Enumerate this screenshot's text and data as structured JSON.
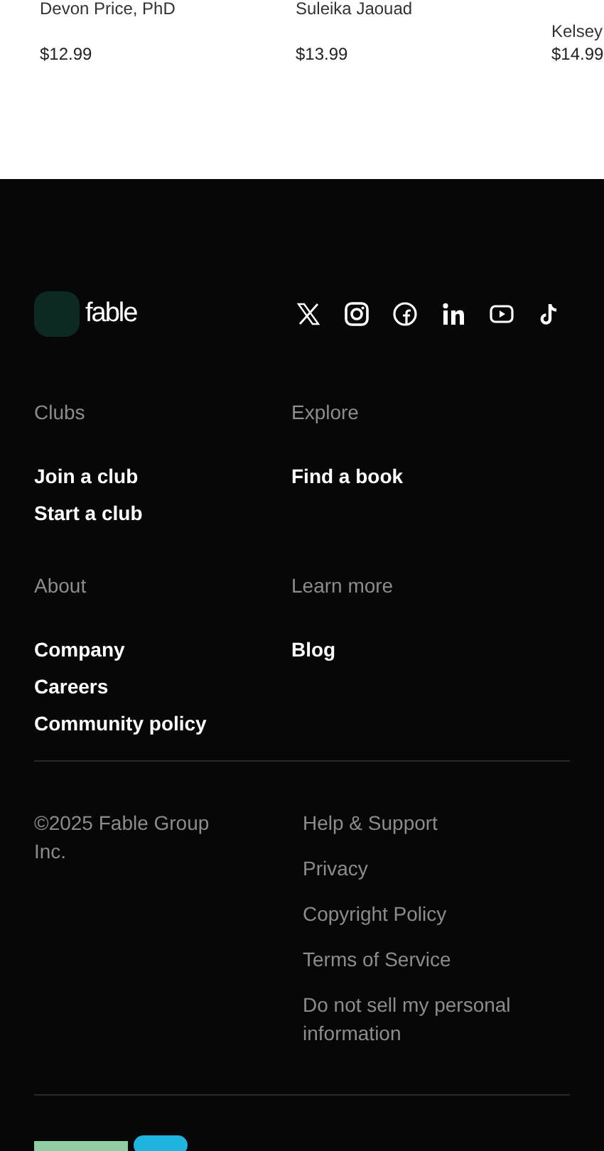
{
  "books": [
    {
      "author": "Devon Price, PhD",
      "price": "$12.99"
    },
    {
      "author": "Suleika Jaouad",
      "price": "$13.99"
    },
    {
      "author": "Kelsey",
      "price": "$14.99"
    }
  ],
  "footer": {
    "brand": "fable",
    "social": [
      {
        "kind": "x"
      },
      {
        "kind": "instagram"
      },
      {
        "kind": "facebook"
      },
      {
        "kind": "linkedin"
      },
      {
        "kind": "youtube"
      },
      {
        "kind": "tiktok"
      }
    ],
    "sections": [
      {
        "heading": "Clubs",
        "links": [
          "Join a club",
          "Start a club"
        ]
      },
      {
        "heading": "Explore",
        "links": [
          "Find a book"
        ]
      },
      {
        "heading": "About",
        "links": [
          "Company",
          "Careers",
          "Community policy"
        ]
      },
      {
        "heading": "Learn more",
        "links": [
          "Blog"
        ]
      }
    ],
    "copyright": "©2025 Fable Group Inc.",
    "legal_links": [
      "Help & Support",
      "Privacy",
      "Copyright Policy",
      "Terms of Service",
      "Do not sell my personal information"
    ]
  }
}
